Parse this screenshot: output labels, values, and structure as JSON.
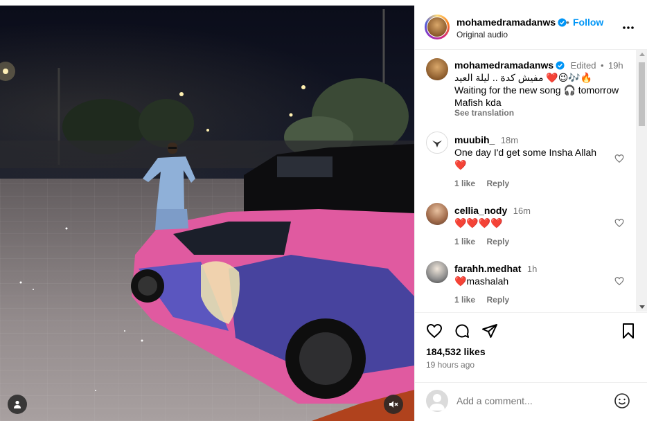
{
  "post": {
    "username": "mohamedramadanws",
    "follow_label": "Follow",
    "separator": "•",
    "audio": "Original audio"
  },
  "caption": {
    "username": "mohamedramadanws",
    "edited": "Edited",
    "dot": "•",
    "time": "19h",
    "line1": "مفيش كدة .. ليلة العيد ❤️😉🎶🔥",
    "line2": "Waiting for the new song 🎧 tomorrow",
    "line3": "Mafish kda",
    "see_translation": "See translation"
  },
  "comments": [
    {
      "username": "muubih_",
      "time": "18m",
      "text": "One day I'd get some Insha Allah",
      "text2": "❤️",
      "likes": "1 like",
      "reply": "Reply"
    },
    {
      "username": "cellia_nody",
      "time": "16m",
      "text": "❤️❤️❤️❤️",
      "likes": "1 like",
      "reply": "Reply"
    },
    {
      "username": "farahh.medhat",
      "time": "1h",
      "text": "❤️mashalah",
      "likes": "1 like",
      "reply": "Reply"
    }
  ],
  "stats": {
    "likes": "184,532 likes",
    "ago": "19 hours ago"
  },
  "add_comment": {
    "placeholder": "Add a comment..."
  },
  "icons": {
    "verified": "verified-badge-icon",
    "more": "more-options-icon",
    "heart": "heart-icon",
    "comment": "comment-icon",
    "share": "share-icon",
    "save": "bookmark-icon",
    "emoji": "emoji-icon",
    "mute": "muted-speaker-icon",
    "tag": "tagged-user-icon"
  },
  "colors": {
    "accent": "#0095f6",
    "verified": "#0095f6",
    "muted_text": "#737373",
    "heart_red": "#e0245e"
  }
}
